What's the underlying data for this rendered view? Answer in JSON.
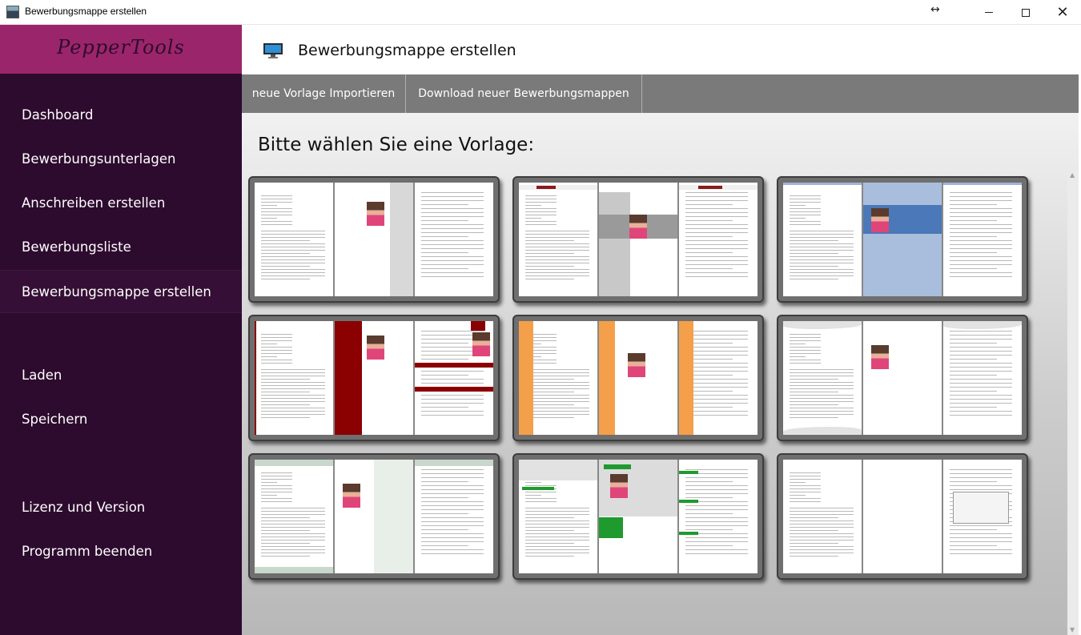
{
  "window": {
    "title": "Bewerbungsmappe erstellen",
    "resize_glyph": "↔",
    "minimize_icon": "minimize-icon",
    "maximize_icon": "maximize-icon",
    "close_glyph": "✕"
  },
  "sidebar": {
    "logo": "PepperTools",
    "items": [
      {
        "label": "Dashboard"
      },
      {
        "label": "Bewerbungsunterlagen"
      },
      {
        "label": "Anschreiben erstellen"
      },
      {
        "label": "Bewerbungsliste"
      },
      {
        "label": "Bewerbungsmappe erstellen",
        "active": true
      },
      {
        "label": "Laden"
      },
      {
        "label": "Speichern"
      },
      {
        "label": "Lizenz und Version"
      },
      {
        "label": "Programm beenden"
      }
    ]
  },
  "header": {
    "icon": "monitor-icon",
    "title": "Bewerbungsmappe erstellen"
  },
  "toolbar": {
    "import_label": "neue Vorlage Importieren",
    "download_label": "Download neuer Bewerbungsmappen"
  },
  "main": {
    "heading": "Bitte wählen Sie eine Vorlage:"
  },
  "templates": [
    {
      "accent": "#ffffff",
      "style": "plain-grey"
    },
    {
      "accent": "#8b1a1a",
      "style": "dark-red"
    },
    {
      "accent": "#9fb3d8",
      "style": "blue"
    },
    {
      "accent": "#8b0000",
      "style": "maroon"
    },
    {
      "accent": "#f4a04a",
      "style": "orange"
    },
    {
      "accent": "#d9d9d9",
      "style": "grey-wave"
    },
    {
      "accent": "#c8d8cc",
      "style": "green-grey"
    },
    {
      "accent": "#1f9a2e",
      "style": "green"
    },
    {
      "accent": "#ffffff",
      "style": "plain-demo"
    }
  ],
  "colors": {
    "sidebar_bg": "#2d0b2e",
    "logo_bg": "#9b256b",
    "toolbar_bg": "#7a7a7a"
  }
}
